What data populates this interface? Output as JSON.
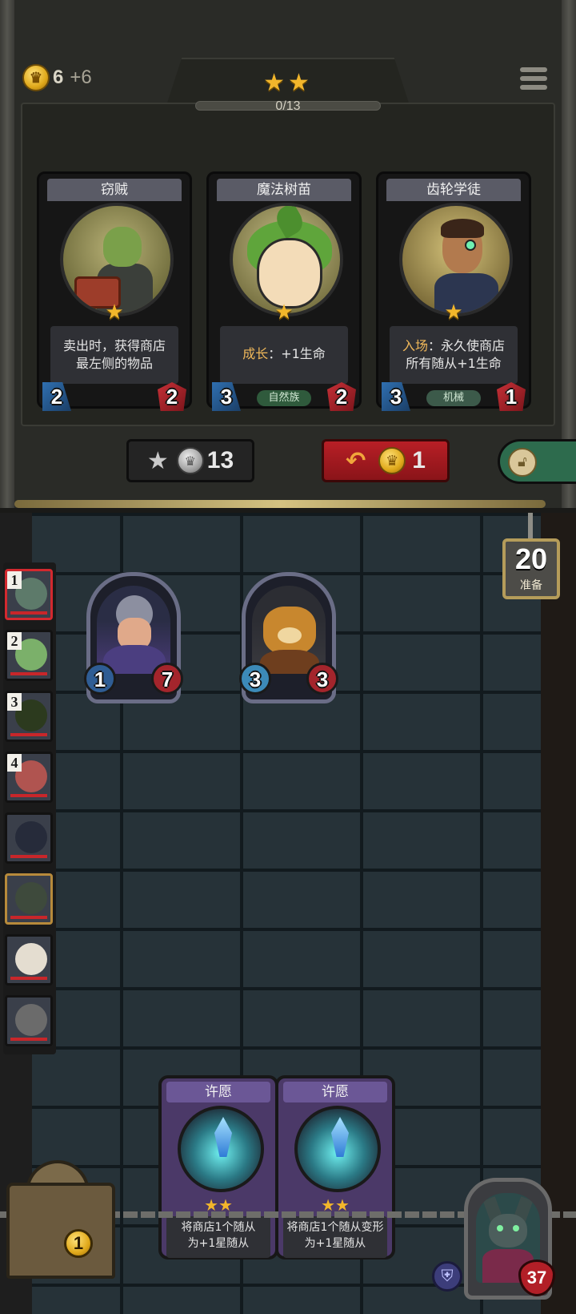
{
  "header": {
    "gold": "6",
    "gold_income": "+6",
    "tier_stars": "★★",
    "tier_progress": "0/13",
    "tier_progress_value": 0
  },
  "shop": {
    "cards": [
      {
        "name": "窃贼",
        "stars": "★",
        "desc_lines": [
          "卖出时，获得商店",
          "最左侧的物品"
        ],
        "attack": "2",
        "health": "2"
      },
      {
        "name": "魔法树苗",
        "stars": "★",
        "keyword": "成长",
        "desc_rest": "：+1生命",
        "tribe": "自然族",
        "attack": "3",
        "health": "2"
      },
      {
        "name": "齿轮学徒",
        "stars": "★",
        "keyword": "入场",
        "desc_rest": "：永久使商店",
        "desc_line2": "所有随从+1生命",
        "tribe": "机械",
        "attack": "3",
        "health": "1"
      }
    ],
    "upgrade_cost": "13",
    "refresh_cost": "1"
  },
  "timer": {
    "value": "20",
    "label": "准备"
  },
  "opponents": [
    {
      "rank": "1"
    },
    {
      "rank": "2"
    },
    {
      "rank": "3"
    },
    {
      "rank": "4"
    }
  ],
  "board": {
    "minions": [
      {
        "attack": "1",
        "health": "7"
      },
      {
        "attack": "3",
        "health": "3"
      }
    ]
  },
  "hand": [
    {
      "name": "许愿",
      "stars": "★★",
      "desc_lines": [
        "将商店1个随从",
        "为+1星随从"
      ]
    },
    {
      "name": "许愿",
      "stars": "★★",
      "desc_lines": [
        "将商店1个随从变形",
        "为+1星随从"
      ]
    }
  ],
  "bottom": {
    "chest_coin": "1",
    "hero_health": "37"
  }
}
